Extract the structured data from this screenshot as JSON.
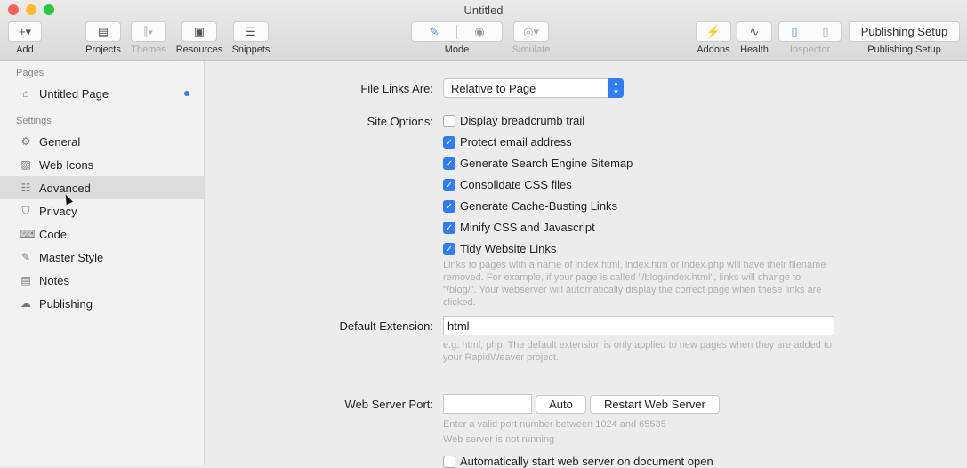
{
  "window": {
    "title": "Untitled"
  },
  "toolbar": {
    "add": "Add",
    "projects": "Projects",
    "themes": "Themes",
    "resources": "Resources",
    "snippets": "Snippets",
    "mode": "Mode",
    "simulate": "Simulate",
    "addons": "Addons",
    "health": "Health",
    "inspector": "Inspector",
    "publishing_setup": "Publishing Setup",
    "publishing_setup_btn": "Publishing Setup"
  },
  "sidebar": {
    "pages_header": "Pages",
    "page": "Untitled Page",
    "settings_header": "Settings",
    "items": [
      {
        "label": "General",
        "icon": "gear-icon"
      },
      {
        "label": "Web Icons",
        "icon": "image-icon"
      },
      {
        "label": "Advanced",
        "icon": "sliders-icon"
      },
      {
        "label": "Privacy",
        "icon": "shield-icon"
      },
      {
        "label": "Code",
        "icon": "code-icon"
      },
      {
        "label": "Master Style",
        "icon": "brush-icon"
      },
      {
        "label": "Notes",
        "icon": "notes-icon"
      },
      {
        "label": "Publishing",
        "icon": "cloud-icon"
      }
    ]
  },
  "main": {
    "file_links_label": "File Links Are:",
    "file_links_value": "Relative to Page",
    "site_options_label": "Site Options:",
    "options": [
      {
        "label": "Display breadcrumb trail",
        "checked": false
      },
      {
        "label": "Protect email address",
        "checked": true
      },
      {
        "label": "Generate Search Engine Sitemap",
        "checked": true
      },
      {
        "label": "Consolidate CSS files",
        "checked": true
      },
      {
        "label": "Generate Cache-Busting Links",
        "checked": true
      },
      {
        "label": "Minify CSS and Javascript",
        "checked": true
      },
      {
        "label": "Tidy Website Links",
        "checked": true
      }
    ],
    "tidy_help": "Links to pages with a name of index.html, index.htm or index.php will have their filename removed. For example, if your page is called \"/blog/index.html\", links will change to \"/blog/\". Your webserver will automatically display the correct page when these links are clicked.",
    "ext_label": "Default Extension:",
    "ext_value": "html",
    "ext_help": "e.g. html, php. The default extension is only applied to new pages when they are added to your RapidWeaver project.",
    "port_label": "Web Server Port:",
    "port_value": "",
    "auto": "Auto",
    "restart": "Restart Web Server",
    "port_help": "Enter a valid port number between 1024 and 65535",
    "server_status": "Web server is not running",
    "autostart": "Automatically start web server on document open"
  }
}
